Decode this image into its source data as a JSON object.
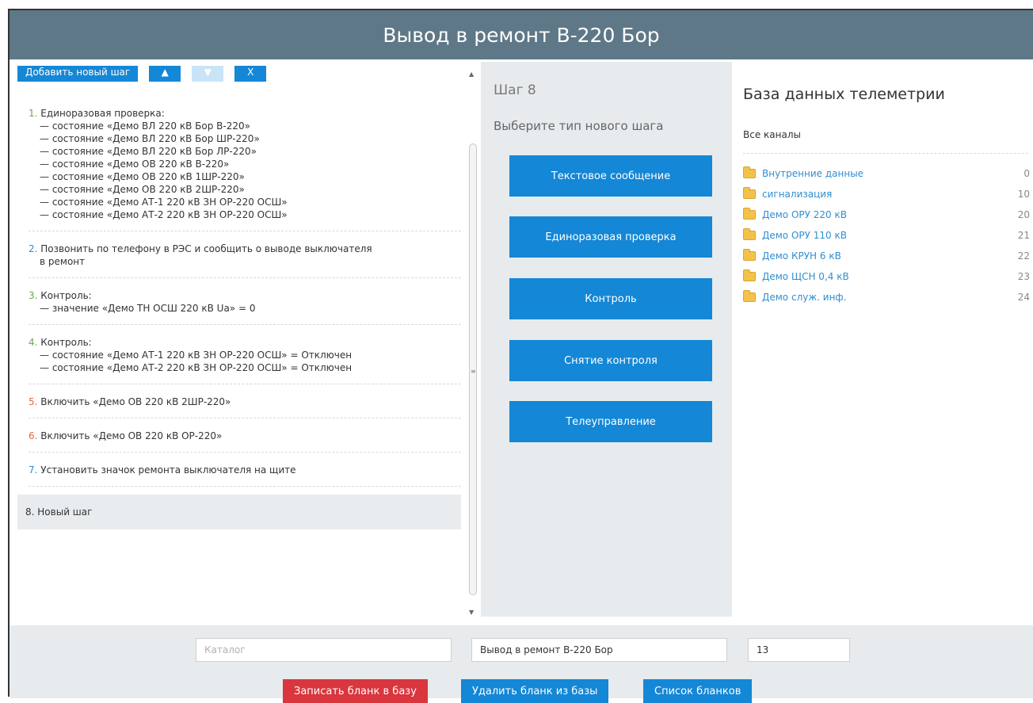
{
  "window": {
    "title": "Вывод в ремонт В-220 Бор"
  },
  "toolbar": {
    "add_step": "Добавить новый шаг",
    "up": "▲",
    "down": "▼",
    "delete": "X"
  },
  "steps": [
    {
      "num": "1.",
      "title": "Единоразовая проверка:",
      "color": "#6aa84f",
      "lines": [
        "— состояние «Демо ВЛ 220 кВ Бор В-220»",
        "— состояние «Демо ВЛ 220 кВ Бор ШР-220»",
        "— состояние «Демо ВЛ 220 кВ Бор ЛР-220»",
        "— состояние «Демо ОВ 220 кВ В-220»",
        "— состояние «Демо ОВ 220 кВ 1ШР-220»",
        "— состояние «Демо ОВ 220 кВ 2ШР-220»",
        "— состояние «Демо АТ-1 220 кВ ЗН ОР-220 ОСШ»",
        "— состояние «Демо АТ-2 220 кВ ЗН ОР-220 ОСШ»"
      ]
    },
    {
      "num": "2.",
      "title": "Позвонить по телефону в РЭС и сообщить о выводе выключателя",
      "color": "#2f8fd0",
      "lines": [
        "в ремонт"
      ]
    },
    {
      "num": "3.",
      "title": "Контроль:",
      "color": "#6aa84f",
      "lines": [
        "— значение «Демо ТН ОСШ 220 кВ Ua» = 0"
      ]
    },
    {
      "num": "4.",
      "title": "Контроль:",
      "color": "#6aa84f",
      "lines": [
        "— состояние «Демо АТ-1 220 кВ ЗН ОР-220 ОСШ» = Отключен",
        "— состояние «Демо АТ-2 220 кВ ЗН ОР-220 ОСШ» = Отключен"
      ]
    },
    {
      "num": "5.",
      "title": "Включить «Демо ОВ 220 кВ 2ШР-220»",
      "color": "#e06c3c",
      "lines": []
    },
    {
      "num": "6.",
      "title": "Включить «Демо ОВ 220 кВ ОР-220»",
      "color": "#e06c3c",
      "lines": []
    },
    {
      "num": "7.",
      "title": "Установить значок ремонта выключателя на щите",
      "color": "#2f8fd0",
      "lines": []
    },
    {
      "num": "8.",
      "title": "Новый шаг",
      "color": "#333333",
      "lines": []
    }
  ],
  "middle": {
    "step_title": "Шаг 8",
    "prompt": "Выберите тип нового шага",
    "types": [
      "Текстовое сообщение",
      "Единоразовая проверка",
      "Контроль",
      "Снятие контроля",
      "Телеуправление"
    ]
  },
  "telemetry": {
    "title": "База данных телеметрии",
    "all_channels": "Все каналы",
    "folders": [
      {
        "name": "Внутренние данные",
        "count": "0"
      },
      {
        "name": "сигнализация",
        "count": "10"
      },
      {
        "name": "Демо ОРУ 220 кВ",
        "count": "20"
      },
      {
        "name": "Демо ОРУ 110 кВ",
        "count": "21"
      },
      {
        "name": "Демо КРУН 6 кВ",
        "count": "22"
      },
      {
        "name": "Демо ЩСН 0,4 кВ",
        "count": "23"
      },
      {
        "name": "Демо служ. инф.",
        "count": "24"
      }
    ]
  },
  "bottom": {
    "catalog_placeholder": "Каталог",
    "name_value": "Вывод в ремонт В-220 Бор",
    "number_value": "13",
    "save_label": "Записать бланк в базу",
    "delete_label": "Удалить бланк из базы",
    "list_label": "Список бланков"
  },
  "colors": {
    "titlebar": "#5e7887",
    "accent": "#1487d6",
    "danger": "#d9363e",
    "panel": "#e7ebee"
  }
}
